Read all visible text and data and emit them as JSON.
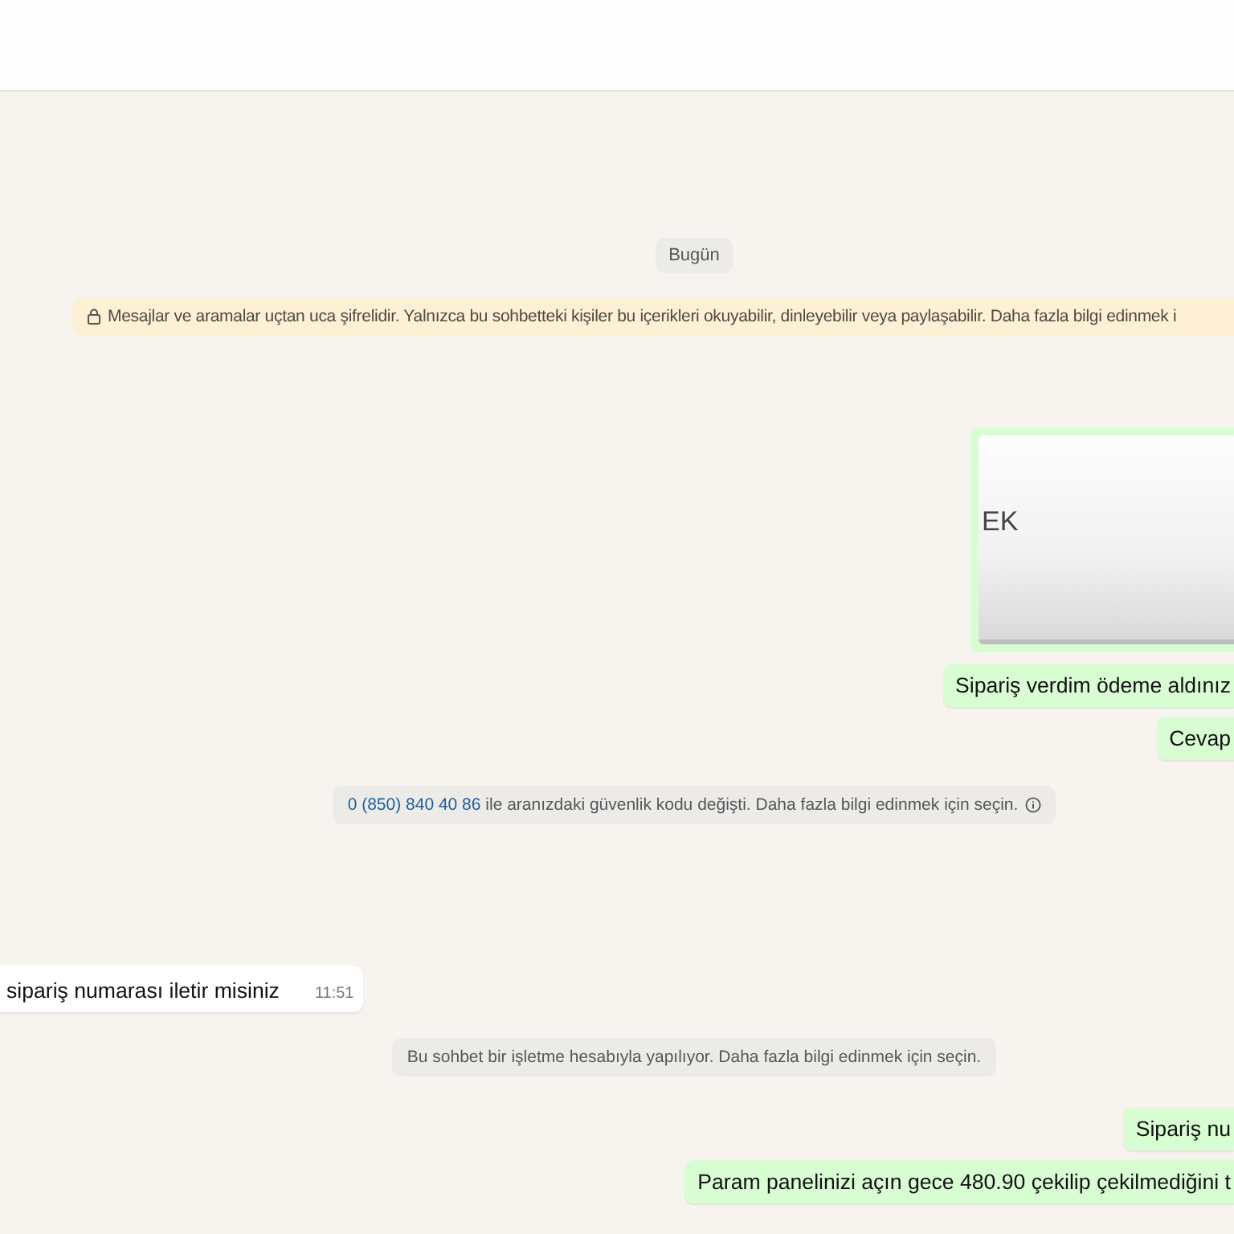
{
  "day_label": "Bugün",
  "encryption_notice": "Mesajlar ve aramalar uçtan uca şifrelidir. Yalnızca bu sohbetteki kişiler bu içerikleri okuyabilir, dinleyebilir veya paylaşabilir. Daha fazla bilgi edinmek i",
  "messages": [
    {
      "kind": "image",
      "outgoing": true,
      "caption": "EK"
    },
    {
      "kind": "text",
      "outgoing": true,
      "text": "Sipariş verdim ödeme aldınız"
    },
    {
      "kind": "text",
      "outgoing": true,
      "text": "Cevap"
    },
    {
      "kind": "notice",
      "phone": "0 (850) 840 40 86",
      "text": "ile aranızdaki güvenlik kodu değişti. Daha fazla bilgi edinmek için seçin."
    },
    {
      "kind": "text",
      "outgoing": false,
      "text": "sipariş numarası iletir misiniz",
      "time": "11:51"
    },
    {
      "kind": "notice",
      "text": "Bu sohbet bir işletme hesabıyla yapılıyor. Daha fazla bilgi edinmek için seçin."
    },
    {
      "kind": "text",
      "outgoing": true,
      "text": "Sipariş nu"
    },
    {
      "kind": "text",
      "outgoing": true,
      "text": "Param panelinizi açın gece 480.90 çekilip çekilmediğini t"
    }
  ]
}
